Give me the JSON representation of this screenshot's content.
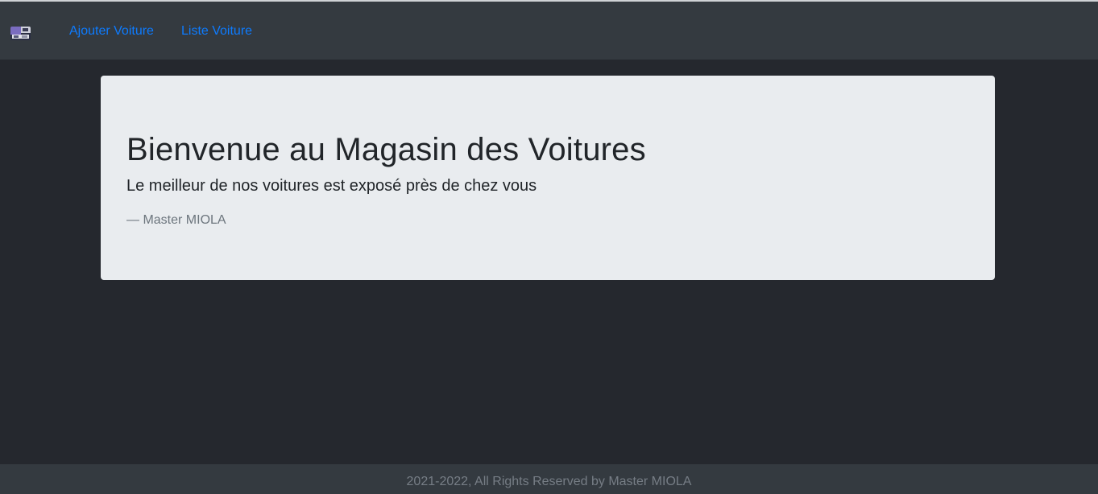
{
  "navbar": {
    "brand_logo": "car-store-logo-icon",
    "links": [
      {
        "label": "Ajouter Voiture"
      },
      {
        "label": "Liste Voiture"
      }
    ]
  },
  "jumbotron": {
    "title": "Bienvenue au Magasin des Voitures",
    "lead": "Le meilleur de nos voitures est exposé près de chez vous",
    "footer": "— Master MIOLA"
  },
  "footer": {
    "text": "2021-2022, All Rights Reserved by Master MIOLA"
  },
  "colors": {
    "page_bg": "#25282e",
    "navbar_bg": "#343a40",
    "link": "#0d7bff",
    "jumbotron_bg": "#e9ecef",
    "footer_text": "#767d85"
  }
}
